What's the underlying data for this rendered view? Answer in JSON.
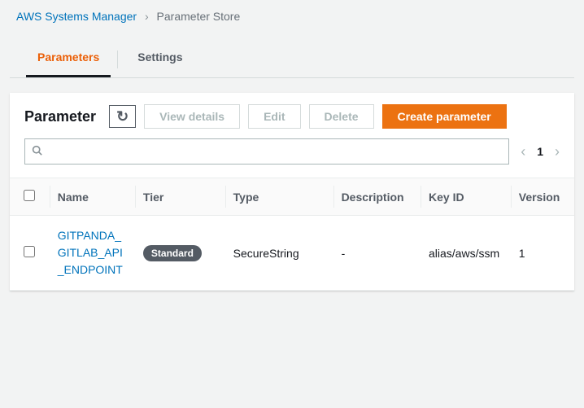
{
  "breadcrumb": {
    "root": "AWS Systems Manager",
    "current": "Parameter Store"
  },
  "tabs": {
    "parameters": "Parameters",
    "settings": "Settings"
  },
  "header": {
    "title": "Parameter",
    "view_details": "View details",
    "edit": "Edit",
    "delete": "Delete",
    "create": "Create parameter"
  },
  "search": {
    "placeholder": ""
  },
  "pager": {
    "page": "1"
  },
  "columns": {
    "name": "Name",
    "tier": "Tier",
    "type": "Type",
    "description": "Description",
    "keyid": "Key ID",
    "version": "Version"
  },
  "rows": [
    {
      "name": "GITPANDA_GITLAB_API_ENDPOINT",
      "tier": "Standard",
      "type": "SecureString",
      "description": "-",
      "keyid": "alias/aws/ssm",
      "version": "1"
    }
  ]
}
